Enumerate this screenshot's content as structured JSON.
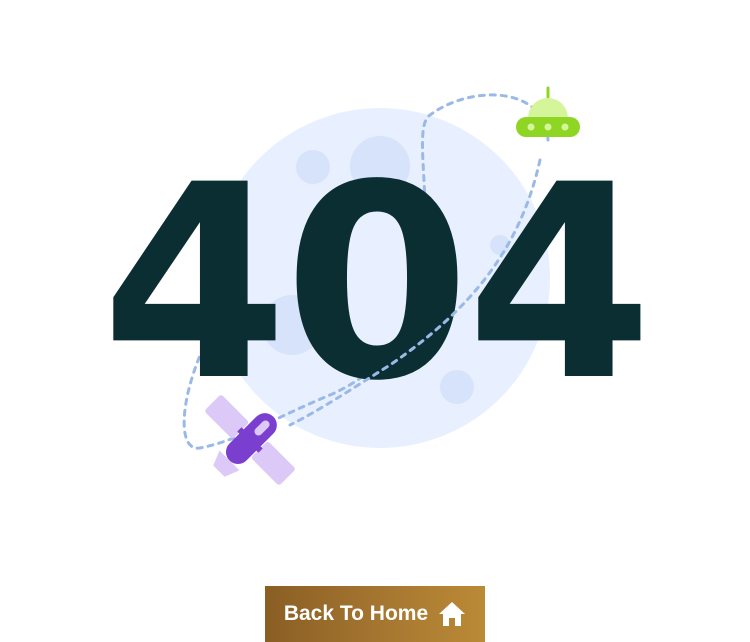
{
  "error": {
    "code": "404"
  },
  "actions": {
    "back_home_label": "Back To Home",
    "back_home_icon": "home-icon"
  },
  "illustration": {
    "elements": [
      "moon",
      "orbit-path",
      "ufo",
      "satellite"
    ],
    "colors": {
      "moon": "#e8f0ff",
      "craters": "#d6e3fb",
      "code_text": "#0b2e33",
      "orbit": "#9bb9e6",
      "ufo_dome": "#d4f59a",
      "ufo_body": "#8fd524",
      "satellite_body": "#7b3fd0",
      "satellite_panels": "#dcc9f7",
      "button_start": "#8a5e24",
      "button_end": "#bb8a36"
    }
  }
}
